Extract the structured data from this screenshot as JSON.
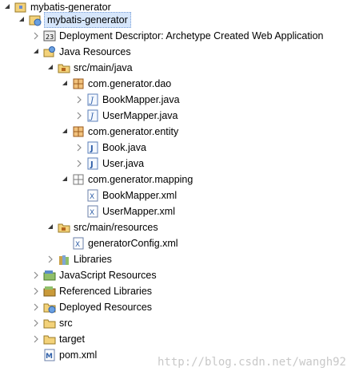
{
  "tree": {
    "workspace_root": "mybatis-generator",
    "project": "mybatis-generator",
    "deployment_descriptor": "Deployment Descriptor: Archetype Created Web Application",
    "java_resources": "Java Resources",
    "src_main_java": "src/main/java",
    "pkg_dao": "com.generator.dao",
    "book_mapper_java": "BookMapper.java",
    "user_mapper_java": "UserMapper.java",
    "pkg_entity": "com.generator.entity",
    "book_java": "Book.java",
    "user_java": "User.java",
    "pkg_mapping": "com.generator.mapping",
    "book_mapper_xml": "BookMapper.xml",
    "user_mapper_xml": "UserMapper.xml",
    "src_main_resources": "src/main/resources",
    "generator_config": "generatorConfig.xml",
    "libraries": "Libraries",
    "javascript_resources": "JavaScript Resources",
    "referenced_libraries": "Referenced Libraries",
    "deployed_resources": "Deployed Resources",
    "src": "src",
    "target": "target",
    "pom": "pom.xml"
  },
  "watermark": "http://blog.csdn.net/wangh92",
  "colors": {
    "selection_bg": "#d6e6fb",
    "folder": "#e9c46a",
    "package": "#b5651d",
    "java_file": "#2f5fa8"
  }
}
